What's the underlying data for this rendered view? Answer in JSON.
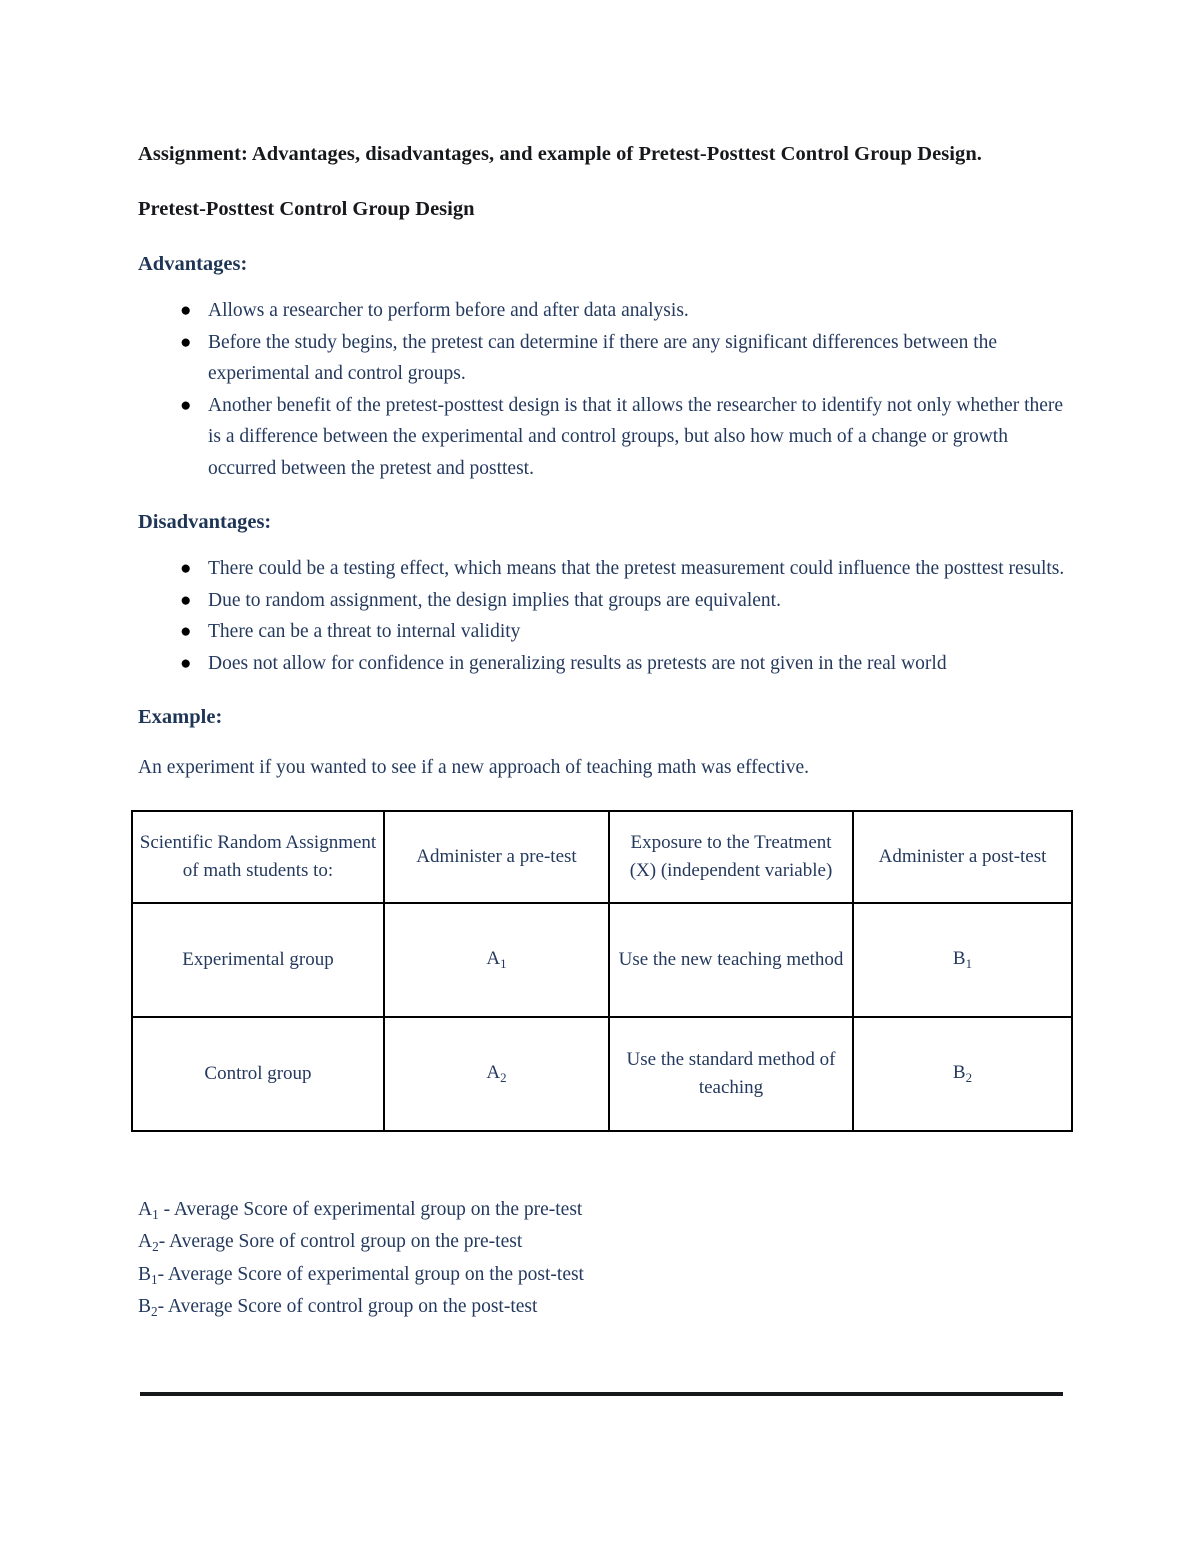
{
  "document": {
    "title": "Assignment: Advantages, disadvantages, and example of Pretest-Posttest Control Group Design.",
    "subheading": "Pretest-Posttest Control Group Design",
    "advantages_heading": "Advantages:",
    "disadvantages_heading": "Disadvantages:",
    "example_heading": "Example:",
    "example_intro": "An experiment if you wanted to see if a new approach of teaching math was effective."
  },
  "advantages": [
    "Allows a researcher to perform before and after data analysis.",
    "Before the study begins, the pretest can determine if there are any significant differences between the experimental and control groups.",
    "Another benefit of the pretest-posttest design is that it allows the researcher to identify not only whether there is a difference between the experimental and control groups, but also how much of a change or growth occurred between the pretest and posttest."
  ],
  "disadvantages": [
    "There could be a testing effect, which means that the pretest measurement could influence the posttest results.",
    "Due to random assignment, the design implies that groups are equivalent.",
    "There can be a threat to internal validity",
    "Does not allow for confidence in generalizing results as pretests are not given in the real world"
  ],
  "table": {
    "headers": [
      "Scientific Random Assignment of math students to:",
      "Administer a pre-test",
      "Exposure to the Treatment (X) (independent variable)",
      "Administer a post-test"
    ],
    "rows": [
      {
        "group": "Experimental  group",
        "pretest": "A1",
        "pretest_base": "A",
        "pretest_sub": "1",
        "treatment": "Use the new teaching method",
        "posttest": "B1",
        "posttest_base": "B",
        "posttest_sub": "1"
      },
      {
        "group": "Control  group",
        "pretest": "A2",
        "pretest_base": "A",
        "pretest_sub": "2",
        "treatment": "Use the standard method of teaching",
        "posttest": "B2",
        "posttest_base": "B",
        "posttest_sub": "2"
      }
    ]
  },
  "legend": [
    {
      "symbol_base": "A",
      "symbol_sub": "1",
      "text": " - Average Score of experimental group on the pre-test"
    },
    {
      "symbol_base": "A",
      "symbol_sub": "2",
      "text": "- Average Sore of control group on the pre-test"
    },
    {
      "symbol_base": "B",
      "symbol_sub": "1",
      "text": "- Average Score of experimental group on the post-test"
    },
    {
      "symbol_base": "B",
      "symbol_sub": "2",
      "text": "- Average Score of control group on the post-test"
    }
  ],
  "colors": {
    "body_text": "#24395e",
    "heading_dark": "#17181c",
    "section_heading": "#1f3556",
    "rule": "#17181c",
    "page_background": "#ffffff"
  }
}
